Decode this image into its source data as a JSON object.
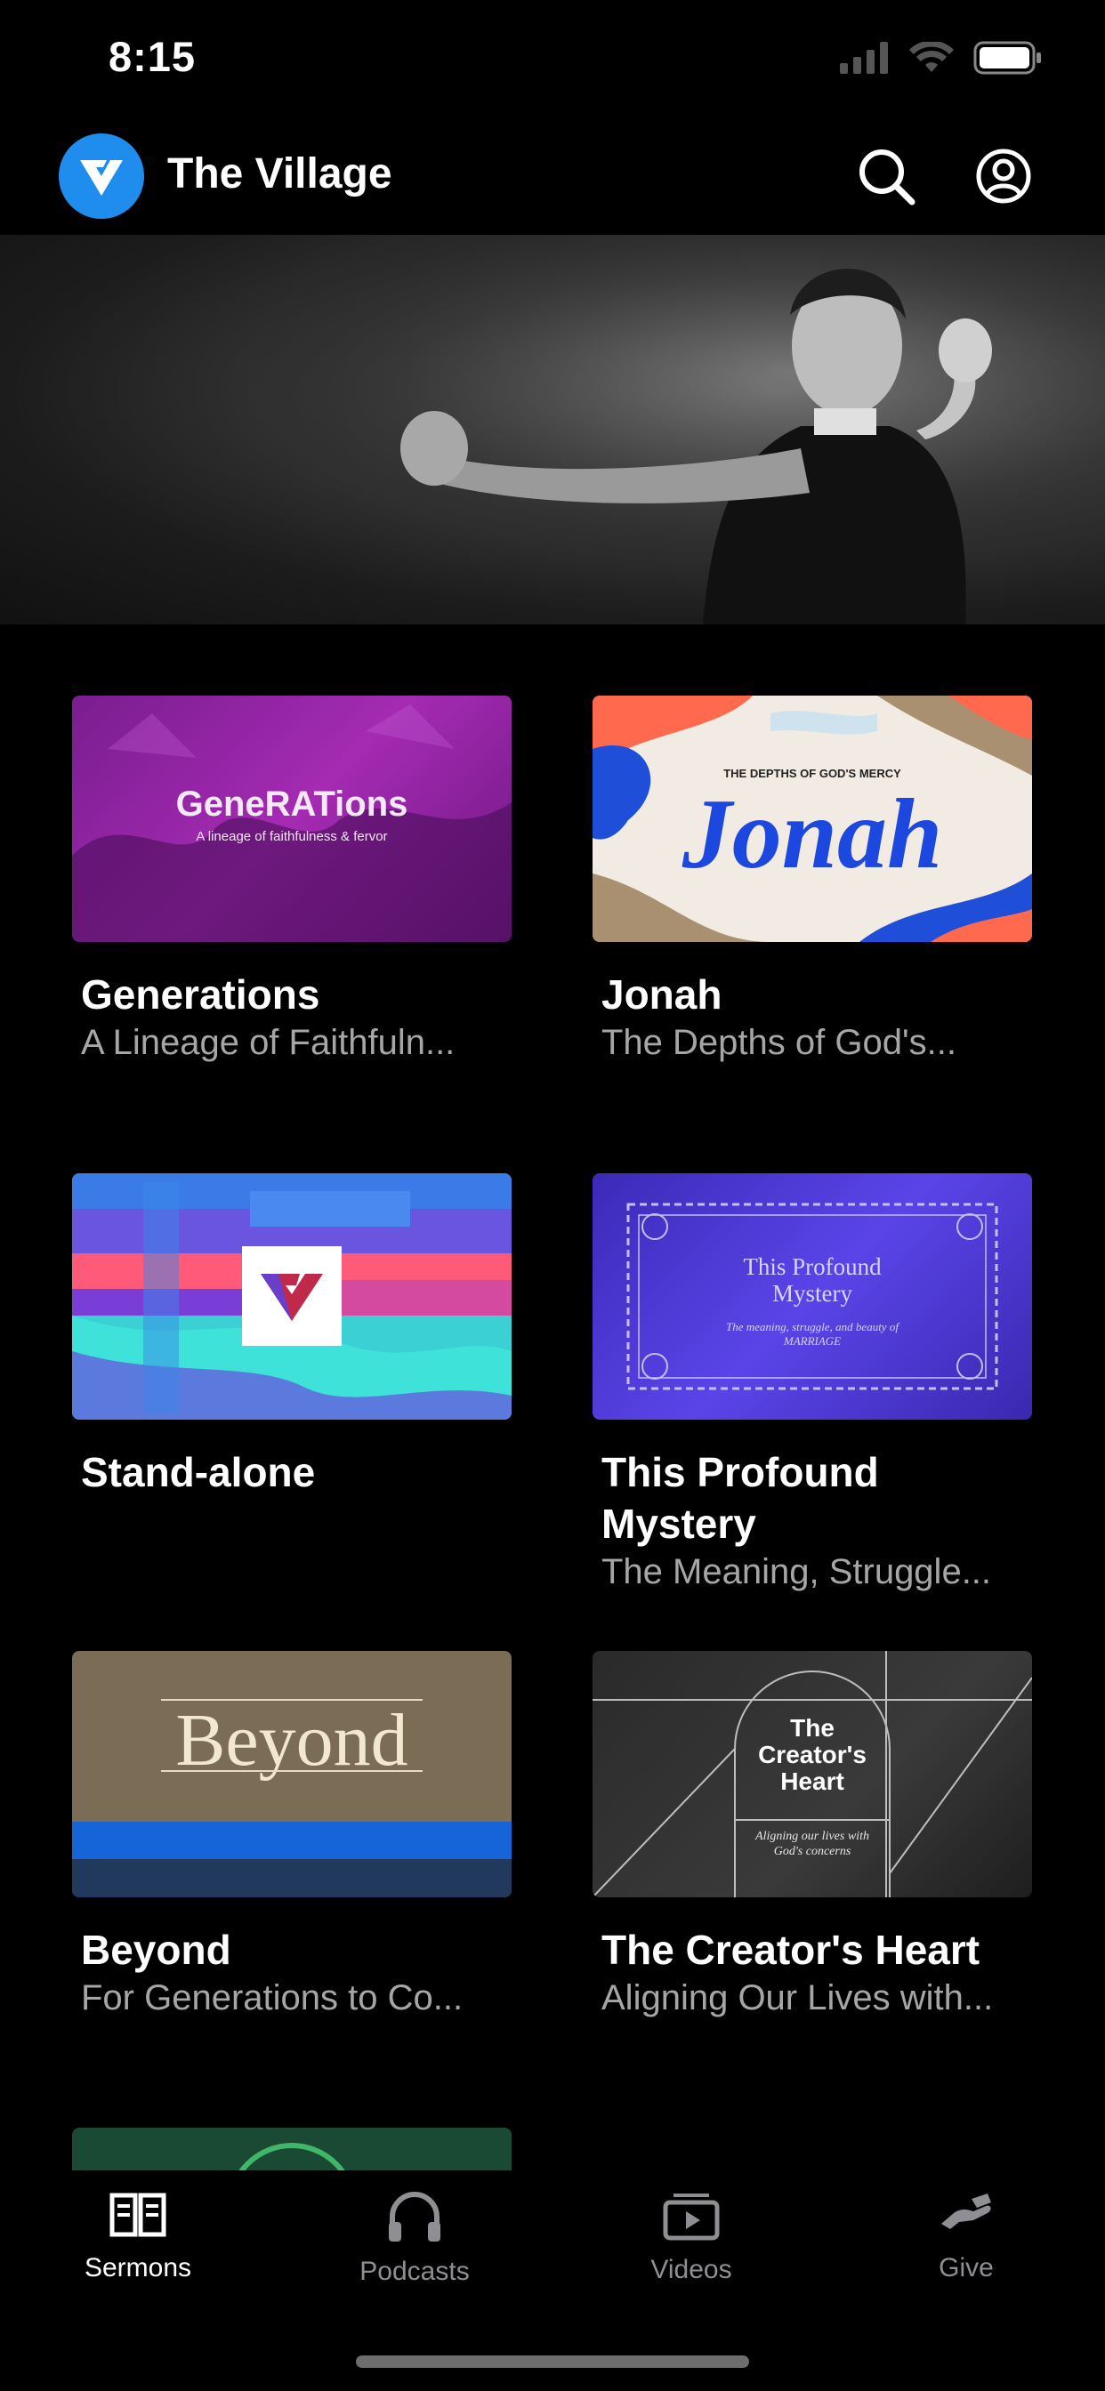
{
  "status": {
    "time": "8:15"
  },
  "header": {
    "title": "The Village"
  },
  "series": [
    {
      "title": "Generations",
      "subtitle": "A Lineage of Faithfuln...",
      "art_title": "GeneRATions",
      "art_sub": "A lineage of faithfulness & fervor"
    },
    {
      "title": "Jonah",
      "subtitle": "The Depths of God's...",
      "art_title": "Jonah",
      "art_sub": "THE DEPTHS OF GOD'S MERCY"
    },
    {
      "title": "Stand-alone",
      "subtitle": ""
    },
    {
      "title": "This Profound Mystery",
      "subtitle": "The Meaning, Struggle...",
      "art_title": "This Profound Mystery",
      "art_sub": "The meaning, struggle, and beauty of MARRIAGE"
    },
    {
      "title": "Beyond",
      "subtitle": "For Generations to Co...",
      "art_title": "Beyond"
    },
    {
      "title": "The Creator's Heart",
      "subtitle": "Aligning Our Lives with...",
      "art_title": "The Creator's Heart",
      "art_sub": "Aligning our lives with God's concerns"
    }
  ],
  "tabs": [
    {
      "label": "Sermons",
      "icon": "book-icon",
      "active": true
    },
    {
      "label": "Podcasts",
      "icon": "headphones-icon",
      "active": false
    },
    {
      "label": "Videos",
      "icon": "video-icon",
      "active": false
    },
    {
      "label": "Give",
      "icon": "give-icon",
      "active": false
    }
  ],
  "colors": {
    "accent": "#1f8ded",
    "muted": "#a6a6a6",
    "tab_inactive": "#8e8e93"
  }
}
